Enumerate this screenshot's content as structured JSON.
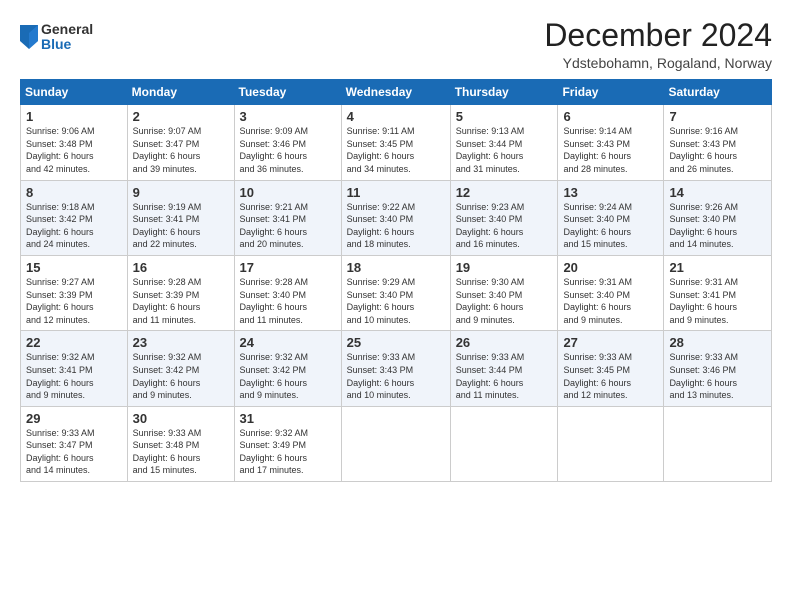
{
  "logo": {
    "general": "General",
    "blue": "Blue"
  },
  "header": {
    "month": "December 2024",
    "location": "Ydstebohamn, Rogaland, Norway"
  },
  "days_of_week": [
    "Sunday",
    "Monday",
    "Tuesday",
    "Wednesday",
    "Thursday",
    "Friday",
    "Saturday"
  ],
  "weeks": [
    [
      {
        "day": "1",
        "info": "Sunrise: 9:06 AM\nSunset: 3:48 PM\nDaylight: 6 hours\nand 42 minutes."
      },
      {
        "day": "2",
        "info": "Sunrise: 9:07 AM\nSunset: 3:47 PM\nDaylight: 6 hours\nand 39 minutes."
      },
      {
        "day": "3",
        "info": "Sunrise: 9:09 AM\nSunset: 3:46 PM\nDaylight: 6 hours\nand 36 minutes."
      },
      {
        "day": "4",
        "info": "Sunrise: 9:11 AM\nSunset: 3:45 PM\nDaylight: 6 hours\nand 34 minutes."
      },
      {
        "day": "5",
        "info": "Sunrise: 9:13 AM\nSunset: 3:44 PM\nDaylight: 6 hours\nand 31 minutes."
      },
      {
        "day": "6",
        "info": "Sunrise: 9:14 AM\nSunset: 3:43 PM\nDaylight: 6 hours\nand 28 minutes."
      },
      {
        "day": "7",
        "info": "Sunrise: 9:16 AM\nSunset: 3:43 PM\nDaylight: 6 hours\nand 26 minutes."
      }
    ],
    [
      {
        "day": "8",
        "info": "Sunrise: 9:18 AM\nSunset: 3:42 PM\nDaylight: 6 hours\nand 24 minutes."
      },
      {
        "day": "9",
        "info": "Sunrise: 9:19 AM\nSunset: 3:41 PM\nDaylight: 6 hours\nand 22 minutes."
      },
      {
        "day": "10",
        "info": "Sunrise: 9:21 AM\nSunset: 3:41 PM\nDaylight: 6 hours\nand 20 minutes."
      },
      {
        "day": "11",
        "info": "Sunrise: 9:22 AM\nSunset: 3:40 PM\nDaylight: 6 hours\nand 18 minutes."
      },
      {
        "day": "12",
        "info": "Sunrise: 9:23 AM\nSunset: 3:40 PM\nDaylight: 6 hours\nand 16 minutes."
      },
      {
        "day": "13",
        "info": "Sunrise: 9:24 AM\nSunset: 3:40 PM\nDaylight: 6 hours\nand 15 minutes."
      },
      {
        "day": "14",
        "info": "Sunrise: 9:26 AM\nSunset: 3:40 PM\nDaylight: 6 hours\nand 14 minutes."
      }
    ],
    [
      {
        "day": "15",
        "info": "Sunrise: 9:27 AM\nSunset: 3:39 PM\nDaylight: 6 hours\nand 12 minutes."
      },
      {
        "day": "16",
        "info": "Sunrise: 9:28 AM\nSunset: 3:39 PM\nDaylight: 6 hours\nand 11 minutes."
      },
      {
        "day": "17",
        "info": "Sunrise: 9:28 AM\nSunset: 3:40 PM\nDaylight: 6 hours\nand 11 minutes."
      },
      {
        "day": "18",
        "info": "Sunrise: 9:29 AM\nSunset: 3:40 PM\nDaylight: 6 hours\nand 10 minutes."
      },
      {
        "day": "19",
        "info": "Sunrise: 9:30 AM\nSunset: 3:40 PM\nDaylight: 6 hours\nand 9 minutes."
      },
      {
        "day": "20",
        "info": "Sunrise: 9:31 AM\nSunset: 3:40 PM\nDaylight: 6 hours\nand 9 minutes."
      },
      {
        "day": "21",
        "info": "Sunrise: 9:31 AM\nSunset: 3:41 PM\nDaylight: 6 hours\nand 9 minutes."
      }
    ],
    [
      {
        "day": "22",
        "info": "Sunrise: 9:32 AM\nSunset: 3:41 PM\nDaylight: 6 hours\nand 9 minutes."
      },
      {
        "day": "23",
        "info": "Sunrise: 9:32 AM\nSunset: 3:42 PM\nDaylight: 6 hours\nand 9 minutes."
      },
      {
        "day": "24",
        "info": "Sunrise: 9:32 AM\nSunset: 3:42 PM\nDaylight: 6 hours\nand 9 minutes."
      },
      {
        "day": "25",
        "info": "Sunrise: 9:33 AM\nSunset: 3:43 PM\nDaylight: 6 hours\nand 10 minutes."
      },
      {
        "day": "26",
        "info": "Sunrise: 9:33 AM\nSunset: 3:44 PM\nDaylight: 6 hours\nand 11 minutes."
      },
      {
        "day": "27",
        "info": "Sunrise: 9:33 AM\nSunset: 3:45 PM\nDaylight: 6 hours\nand 12 minutes."
      },
      {
        "day": "28",
        "info": "Sunrise: 9:33 AM\nSunset: 3:46 PM\nDaylight: 6 hours\nand 13 minutes."
      }
    ],
    [
      {
        "day": "29",
        "info": "Sunrise: 9:33 AM\nSunset: 3:47 PM\nDaylight: 6 hours\nand 14 minutes."
      },
      {
        "day": "30",
        "info": "Sunrise: 9:33 AM\nSunset: 3:48 PM\nDaylight: 6 hours\nand 15 minutes."
      },
      {
        "day": "31",
        "info": "Sunrise: 9:32 AM\nSunset: 3:49 PM\nDaylight: 6 hours\nand 17 minutes."
      },
      {
        "day": "",
        "info": ""
      },
      {
        "day": "",
        "info": ""
      },
      {
        "day": "",
        "info": ""
      },
      {
        "day": "",
        "info": ""
      }
    ]
  ]
}
